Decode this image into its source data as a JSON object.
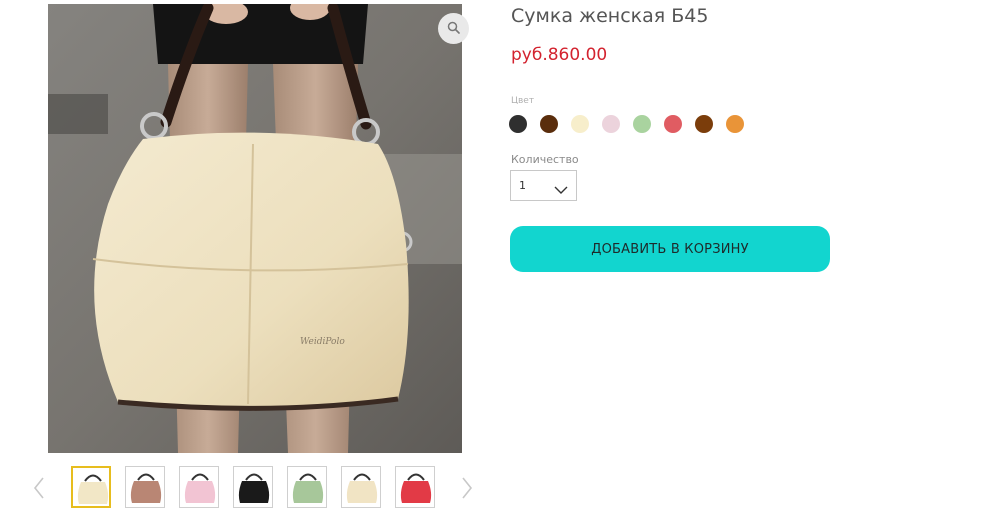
{
  "product": {
    "title": "Сумка женская Б45",
    "price": "руб.860.00"
  },
  "color_option": {
    "label": "Цвет",
    "swatches": [
      {
        "name": "black",
        "hex": "#2f2f2f"
      },
      {
        "name": "dark-brown",
        "hex": "#5a2d0c"
      },
      {
        "name": "cream",
        "hex": "#f7eecb"
      },
      {
        "name": "light-pink",
        "hex": "#ecd3dc"
      },
      {
        "name": "light-green",
        "hex": "#a9d39f"
      },
      {
        "name": "red",
        "hex": "#e05c62"
      },
      {
        "name": "brown",
        "hex": "#7b3d0b"
      },
      {
        "name": "orange",
        "hex": "#e99438"
      }
    ]
  },
  "quantity": {
    "label": "Количество",
    "value": "1"
  },
  "cart_button": {
    "label": "ДОБАВИТЬ В КОРЗИНУ"
  },
  "gallery": {
    "zoom_icon": "magnifier-icon",
    "prev_icon": "chevron-left-icon",
    "next_icon": "chevron-right-icon",
    "main_bag_text": "WeidiPolo",
    "thumbnails": [
      {
        "color": "#f2e7c6",
        "active": true
      },
      {
        "color": "#b98674",
        "active": false
      },
      {
        "color": "#f2c4d3",
        "active": false
      },
      {
        "color": "#1a1a1a",
        "active": false
      },
      {
        "color": "#a7c79a",
        "active": false
      },
      {
        "color": "#f1e4c4",
        "active": false
      },
      {
        "color": "#e23a46",
        "active": false
      }
    ]
  },
  "colors": {
    "price": "#d3232f",
    "button": "#12d5cf",
    "active_thumb_border": "#e7bd1e"
  }
}
